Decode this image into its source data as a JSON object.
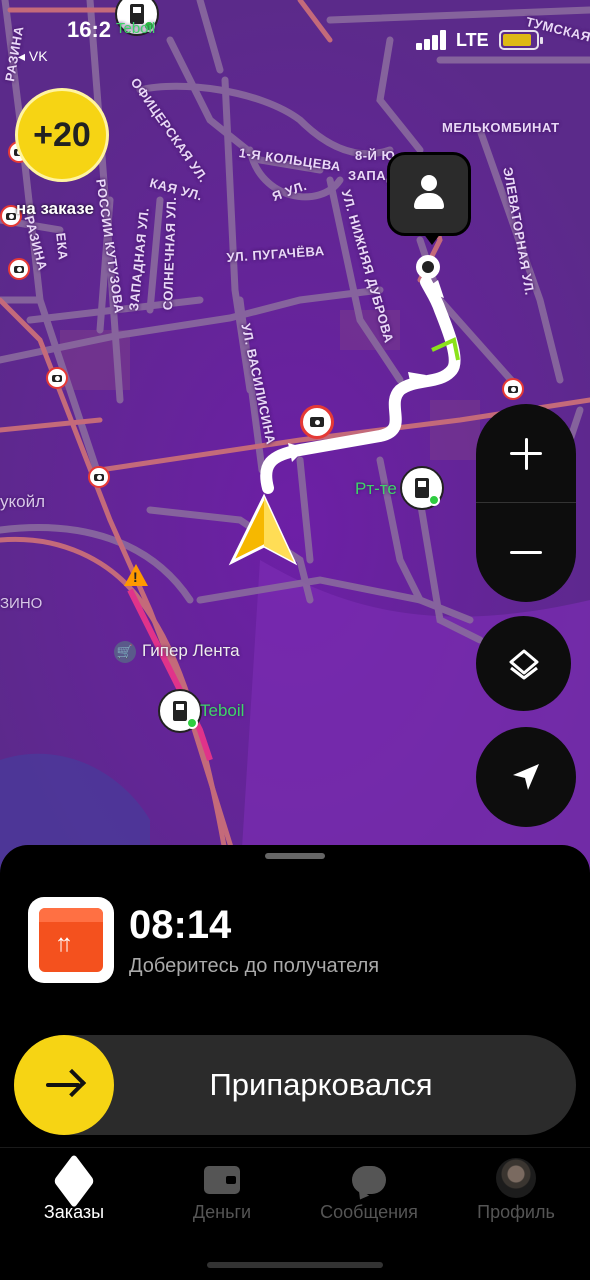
{
  "status_bar": {
    "time": "16:2",
    "back_app": "◂ VK",
    "network": "LTE"
  },
  "map": {
    "bonus_badge": "+20",
    "bonus_caption": "на заказе",
    "streets": [
      "ТУМСКАЯ",
      "РАЗИНА",
      "ОФИЦЕРСКАЯ УЛ.",
      "1-Я КОЛЬЦЕВА",
      "Я УЛ.",
      "8-Й Ю",
      "ЗАПАД",
      "МЕЛЬКОМБИНАТ",
      "ЭЛЕВАТОРНАЯ УЛ.",
      "УЛ. ПУГАЧЁВА",
      "ЗАПАДНАЯ УЛ.",
      "СОЛНЕЧНАЯ УЛ.",
      "РОССИИ КУТУЗОВА",
      "ЕКА",
      "УЛ. НИЖНЯЯ ДУБРОВА",
      "УЛ. ВАСИЛИСИНА",
      "КАЯ УЛ.",
      "РАЗИНА",
      "укойл",
      "ЗИНО"
    ],
    "pois": {
      "gas_top": "Teboil",
      "gas_mid": "Рт-те",
      "gas_bottom": "Teboil",
      "store": "Гипер Лента"
    },
    "icons": {
      "navigation_arrow": "navigation-arrow-icon",
      "destination": "person-icon",
      "zoom_in": "plus-icon",
      "zoom_out": "minus-icon",
      "layers": "layers-icon",
      "locate": "locate-arrow-icon"
    },
    "colors": {
      "map_background": "#6a2a9c",
      "route": "#ffffff",
      "traffic_green": "#8be21b",
      "accent_yellow": "#f6d414"
    }
  },
  "order_sheet": {
    "eta": "08:14",
    "instruction": "Доберитесь до получателя",
    "slider_label": "Припарковался"
  },
  "tab_bar": {
    "tabs": [
      {
        "label": "Заказы",
        "icon": "package-icon",
        "active": true
      },
      {
        "label": "Деньги",
        "icon": "wallet-icon",
        "active": false
      },
      {
        "label": "Сообщения",
        "icon": "chat-bubble-icon",
        "active": false
      },
      {
        "label": "Профиль",
        "icon": "avatar-icon",
        "active": false
      }
    ]
  }
}
